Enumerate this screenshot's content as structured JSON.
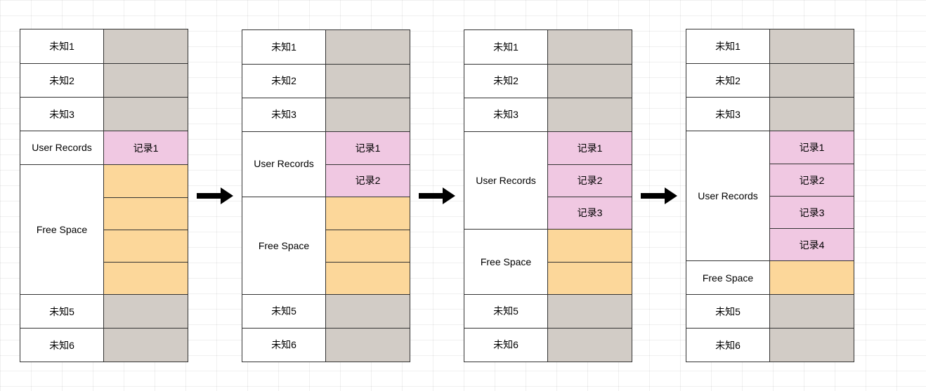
{
  "labels": {
    "unknown1": "未知1",
    "unknown2": "未知2",
    "unknown3": "未知3",
    "unknown5": "未知5",
    "unknown6": "未知6",
    "user_records_stacked": "User Records",
    "user_records": "User Records",
    "free_space": "Free Space"
  },
  "records": {
    "r1": "记录1",
    "r2": "记录2",
    "r3": "记录3",
    "r4": "记录4"
  },
  "colors": {
    "grey": "#d2ccc6",
    "pink": "#f0c8e2",
    "orange": "#fcd79a",
    "border": "#333333"
  },
  "diagrams": [
    {
      "user_record_count": 1,
      "free_space_count": 4
    },
    {
      "user_record_count": 2,
      "free_space_count": 3
    },
    {
      "user_record_count": 3,
      "free_space_count": 2
    },
    {
      "user_record_count": 4,
      "free_space_count": 1
    }
  ]
}
